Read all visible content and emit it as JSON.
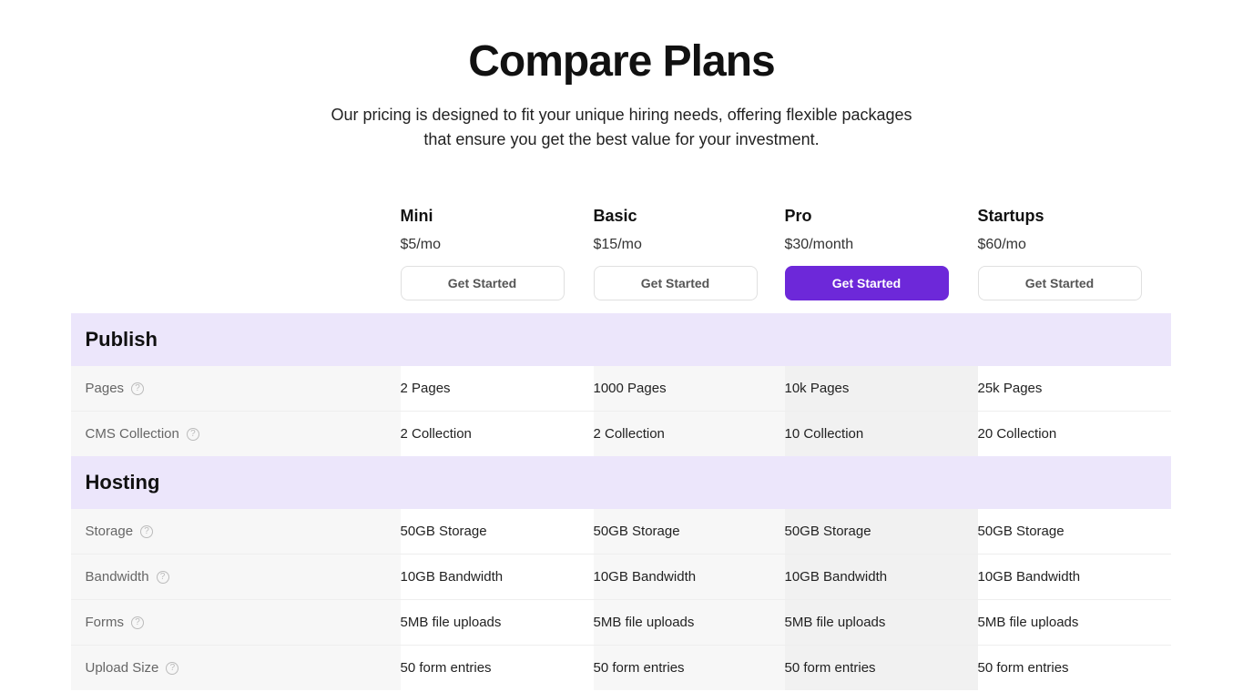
{
  "header": {
    "title": "Compare Plans",
    "subtitle": "Our pricing is designed to fit your unique hiring needs, offering flexible packages that ensure you get the best value for your investment."
  },
  "plans": [
    {
      "name": "Mini",
      "price": "$5/mo",
      "cta": "Get Started",
      "primary": false
    },
    {
      "name": "Basic",
      "price": "$15/mo",
      "cta": "Get Started",
      "primary": false
    },
    {
      "name": "Pro",
      "price": "$30/month",
      "cta": "Get Started",
      "primary": true
    },
    {
      "name": "Startups",
      "price": "$60/mo",
      "cta": "Get Started",
      "primary": false
    }
  ],
  "sections": [
    {
      "title": "Publish",
      "rows": [
        {
          "label": "Pages",
          "help": true,
          "values": [
            "2 Pages",
            "1000 Pages",
            "10k Pages",
            "25k Pages"
          ]
        },
        {
          "label": "CMS Collection",
          "help": true,
          "values": [
            "2 Collection",
            "2 Collection",
            "10 Collection",
            "20 Collection"
          ]
        }
      ]
    },
    {
      "title": "Hosting",
      "rows": [
        {
          "label": "Storage",
          "help": true,
          "values": [
            "50GB Storage",
            "50GB Storage",
            "50GB Storage",
            "50GB Storage"
          ]
        },
        {
          "label": "Bandwidth",
          "help": true,
          "values": [
            "10GB Bandwidth",
            "10GB Bandwidth",
            "10GB Bandwidth",
            "10GB Bandwidth"
          ]
        },
        {
          "label": "Forms",
          "help": true,
          "values": [
            "5MB file uploads",
            "5MB file uploads",
            "5MB file uploads",
            "5MB file uploads"
          ]
        },
        {
          "label": "Upload Size",
          "help": true,
          "values": [
            "50 form entries",
            "50 form entries",
            "50 form entries",
            "50 form entries"
          ]
        }
      ]
    }
  ]
}
